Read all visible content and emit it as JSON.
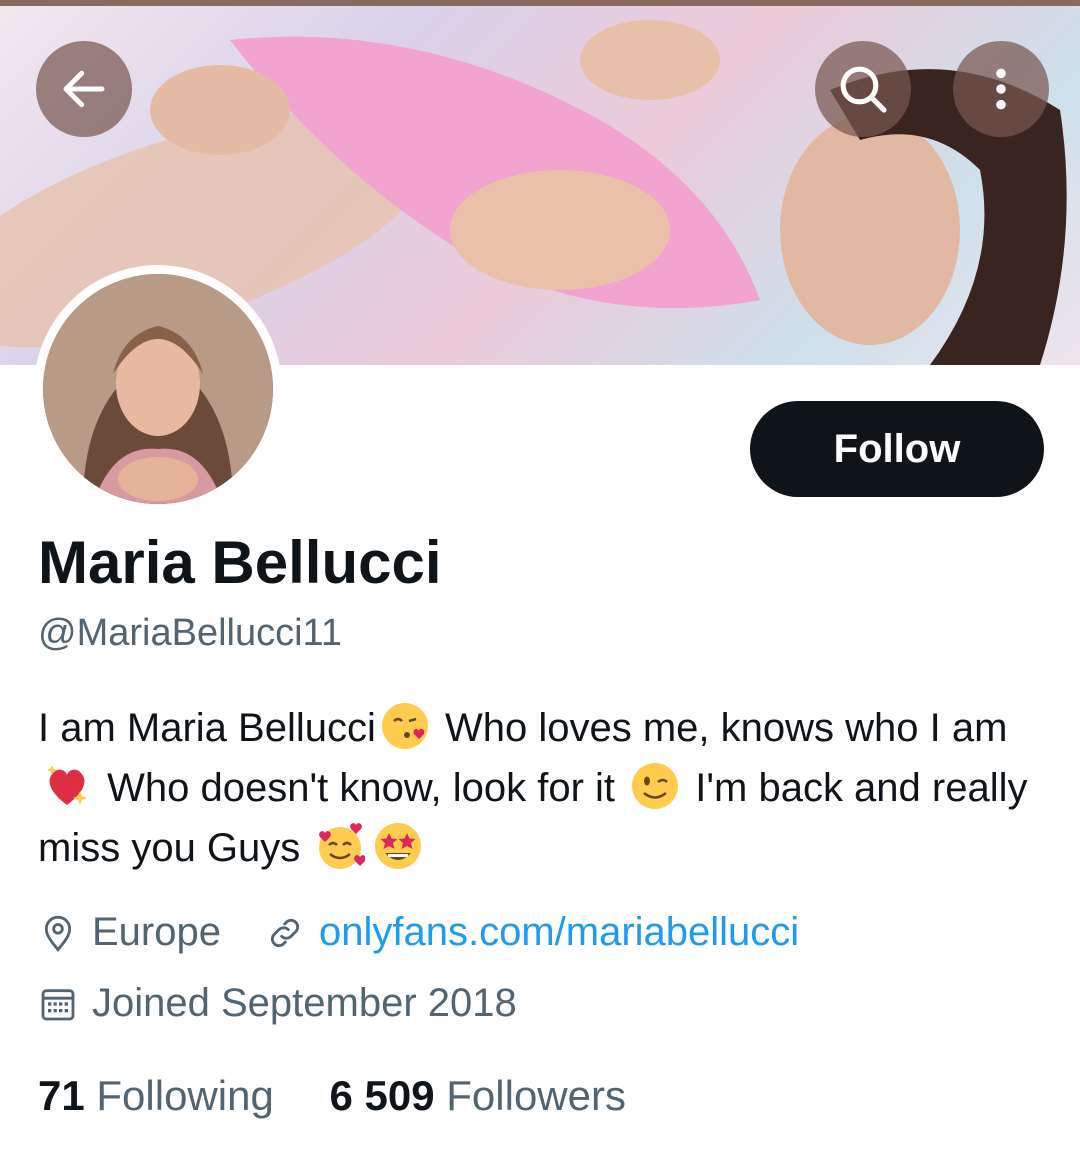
{
  "header": {
    "back_icon": "arrow-left-icon",
    "search_icon": "search-icon",
    "more_icon": "more-vertical-icon",
    "banner_description": "profile-banner-photo",
    "banner_colors": [
      "#f3e7ef",
      "#d9d2ea",
      "#eccad9",
      "#cde0ec"
    ]
  },
  "profile": {
    "follow_label": "Follow",
    "name": "Maria Bellucci",
    "handle": "@MariaBellucci11",
    "bio": {
      "part1": "I am Maria Bellucci",
      "part2": "Who loves me, knows who I am",
      "part3": "Who doesn't know, look for it",
      "part4": "I'm back and really miss you Guys",
      "emojis": [
        "face-blowing-kiss",
        "sparkling-heart",
        "winking-face",
        "smiling-face-with-hearts",
        "star-struck"
      ]
    },
    "location": "Europe",
    "website": "onlyfans.com/mariabellucci",
    "joined": "Joined September 2018",
    "following_count": "71",
    "following_label": "Following",
    "followers_count": "6 509",
    "followers_label": "Followers"
  },
  "colors": {
    "accent": "#1d9bf0",
    "text_primary": "#0f1419",
    "text_secondary": "#536471",
    "button_dark": "#0f1419"
  }
}
